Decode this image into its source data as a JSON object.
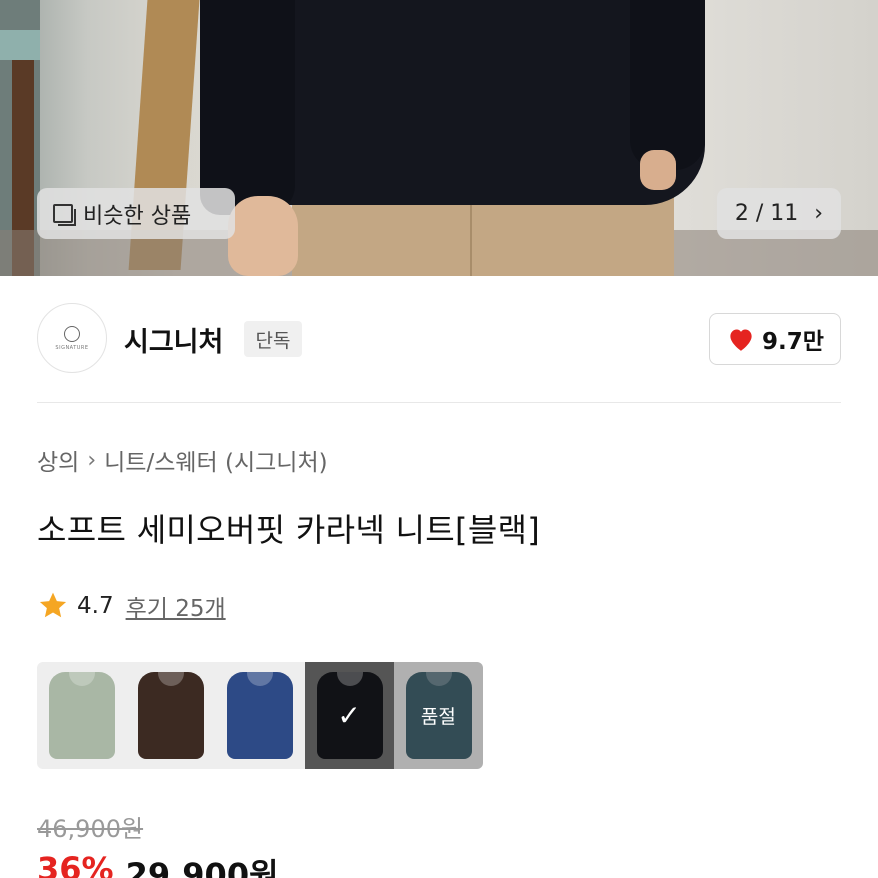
{
  "hero": {
    "similar_label": "비슷한 상품",
    "counter": "2 / 11",
    "counter_arrow": "›"
  },
  "brand": {
    "logo_text": "SIGNATURE",
    "name": "시그니처",
    "badge": "단독",
    "likes": "9.7만"
  },
  "breadcrumb": {
    "category": "상의",
    "separator": "›",
    "subcategory": "니트/스웨터 (시그니처)"
  },
  "product": {
    "title": "소프트 세미오버핏 카라넥 니트[블랙]"
  },
  "rating": {
    "score": "4.7",
    "reviews": "후기 25개"
  },
  "swatches": [
    {
      "color": "#a9b7a5",
      "selected": false,
      "label": ""
    },
    {
      "color": "#3c2a22",
      "selected": false,
      "label": ""
    },
    {
      "color": "#2d4a86",
      "selected": false,
      "label": ""
    },
    {
      "color": "#111216",
      "selected": true,
      "label": "✓"
    },
    {
      "color": "#2f5563",
      "selected": false,
      "label": "품절"
    }
  ],
  "price": {
    "original": "46,900원",
    "discount": "36%",
    "final": "29,900원"
  },
  "colors": {
    "accent_red": "#e52420",
    "star": "#f5a623"
  }
}
